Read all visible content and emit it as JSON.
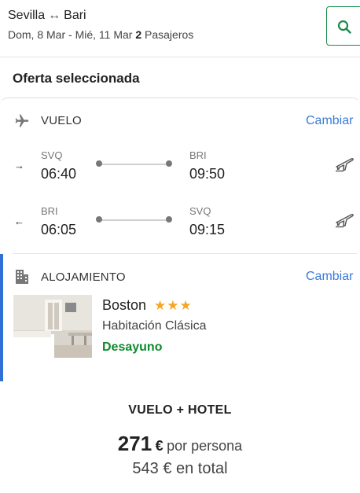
{
  "search": {
    "origin": "Sevilla",
    "swap_symbol": "↔",
    "destination": "Bari",
    "dates": "Dom, 8 Mar - Mié, 11 Mar",
    "passengers_count": "2",
    "passengers_label": "Pasajeros"
  },
  "offer_title": "Oferta seleccionada",
  "flight": {
    "label": "VUELO",
    "change_label": "Cambiar",
    "outbound": {
      "direction_symbol": "→",
      "from_code": "SVQ",
      "from_time": "06:40",
      "to_code": "BRI",
      "to_time": "09:50"
    },
    "return": {
      "direction_symbol": "←",
      "from_code": "BRI",
      "from_time": "06:05",
      "to_code": "SVQ",
      "to_time": "09:15"
    }
  },
  "accommodation": {
    "label": "ALOJAMIENTO",
    "change_label": "Cambiar",
    "hotel_name": "Boston",
    "stars": "★★★",
    "room_type": "Habitación Clásica",
    "board": "Desayuno"
  },
  "package": {
    "title": "VUELO + HOTEL",
    "price_amount": "271",
    "currency": "€",
    "per_person_label": "por persona",
    "total_amount": "543",
    "total_label": "en total"
  },
  "colors": {
    "accent": "#3b7bd6",
    "brand_green": "#1a8b4b",
    "board_green": "#0e8a2e",
    "star": "#f5a623",
    "hotel_bar": "#2f6fd6"
  },
  "icons": [
    "search-icon",
    "plane-icon",
    "building-icon",
    "plane-takeoff-icon"
  ]
}
